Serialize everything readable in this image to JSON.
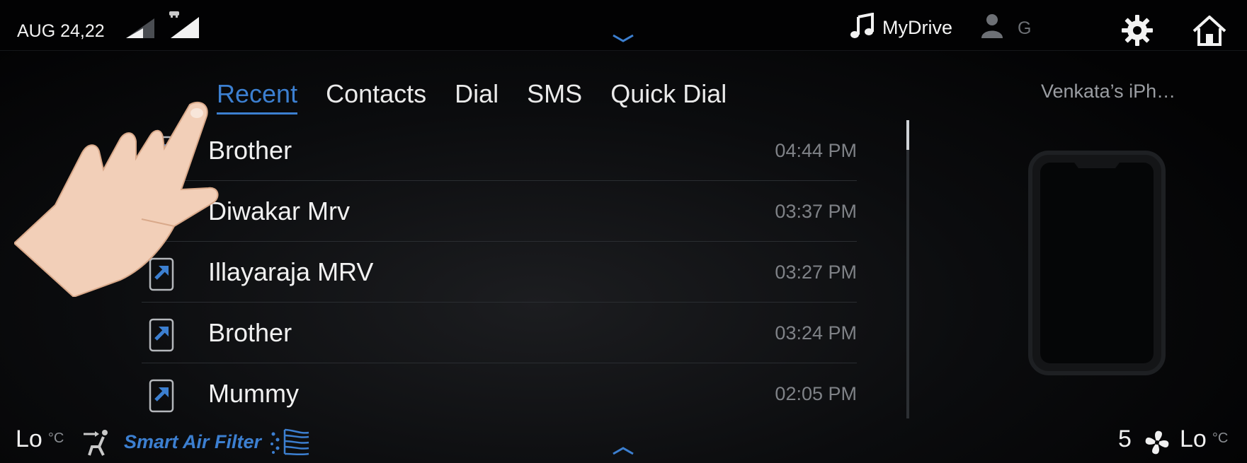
{
  "status_bar": {
    "date": "AUG 24,22",
    "media_label": "MyDrive",
    "user_initial": "G",
    "icons": [
      "signal-strength-icon",
      "network-signal-icon",
      "pull-down-chevron-icon",
      "music-note-icon",
      "user-profile-icon",
      "gear-icon",
      "home-icon"
    ]
  },
  "tabs": [
    {
      "label": "Recent",
      "active": true
    },
    {
      "label": "Contacts",
      "active": false
    },
    {
      "label": "Dial",
      "active": false
    },
    {
      "label": "SMS",
      "active": false
    },
    {
      "label": "Quick Dial",
      "active": false
    }
  ],
  "device": {
    "name": "Venkata’s iPh…"
  },
  "calls": [
    {
      "name": "Brother",
      "time": "04:44 PM",
      "type": "outgoing"
    },
    {
      "name": "Diwakar Mrv",
      "time": "03:37 PM",
      "type": "incoming"
    },
    {
      "name": "Illayaraja MRV",
      "time": "03:27 PM",
      "type": "outgoing"
    },
    {
      "name": "Brother",
      "time": "03:24 PM",
      "type": "outgoing"
    },
    {
      "name": "Mummy",
      "time": "02:05 PM",
      "type": "outgoing"
    }
  ],
  "climate": {
    "left_temp": "Lo",
    "left_unit": "°C",
    "smart_air_filter": "Smart Air Filter",
    "fan_speed": "5",
    "right_temp": "Lo",
    "right_unit": "°C"
  },
  "colors": {
    "accent": "#3c7fd0",
    "incoming_call": "#2fa84f",
    "background": "#050607",
    "muted_text": "#7f8287"
  }
}
